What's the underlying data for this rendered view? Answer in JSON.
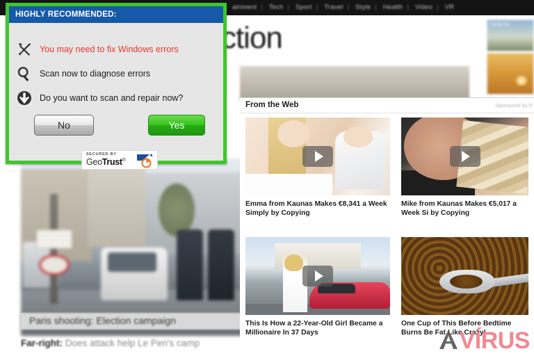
{
  "alert": {
    "title": "HIGHLY RECOMMENDED:",
    "rows": [
      {
        "icon": "wrench-screwdriver-icon",
        "text": "You may need to fix Windows errors",
        "color": "#e8352c"
      },
      {
        "icon": "magnifier-icon",
        "text": "Scan now to diagnose errors",
        "color": "#1a1a1a"
      },
      {
        "icon": "download-arrow-icon",
        "text": "Do you want to scan and repair now?",
        "color": "#1a1a1a"
      }
    ],
    "buttons": {
      "no": "No",
      "yes": "Yes"
    },
    "badge": {
      "secured_by": "SECURED BY",
      "brand_prefix": "Geo",
      "brand_suffix": "Trust",
      "registered": "®"
    },
    "colors": {
      "border": "#3ec62b",
      "titlebar": "#1659a8",
      "body": "#e6e6e6",
      "warning": "#e8352c",
      "yes": "#36c31f"
    }
  },
  "page": {
    "topnav": [
      "ainment",
      "Tech",
      "Sport",
      "Travel",
      "Style",
      "Health",
      "Video",
      "VR"
    ],
    "headline": "its election",
    "hero_caption": "Paris shooting: Election campaign",
    "sub_caption_label": "Far-right:",
    "sub_caption_text": "Does attack help Le Pen's camp",
    "mini_photo_label": "North Ko"
  },
  "from_the_web": {
    "title": "From the Web",
    "sponsor": "Sponsored by R",
    "items": [
      {
        "caption": "Emma from Kaunas Makes €8,341 a Week Simply by Copying",
        "thumb": "thumb-a",
        "has_play": true
      },
      {
        "caption": "Mike from Kaunas Makes €5,017 a Week Si by Copying",
        "thumb": "thumb-b",
        "has_play": true
      },
      {
        "caption": "This Is How a 22-Year-Old Girl Became a Millionaire In 37 Days",
        "thumb": "thumb-c",
        "has_play": true
      },
      {
        "caption": "One Cup of This Before Bedtime Burns Be Fat Like Crazy!",
        "thumb": "thumb-d",
        "has_play": false
      }
    ]
  },
  "watermark": {
    "text": "VÍRUS",
    "mark": "A",
    "color": "#f0808a"
  }
}
